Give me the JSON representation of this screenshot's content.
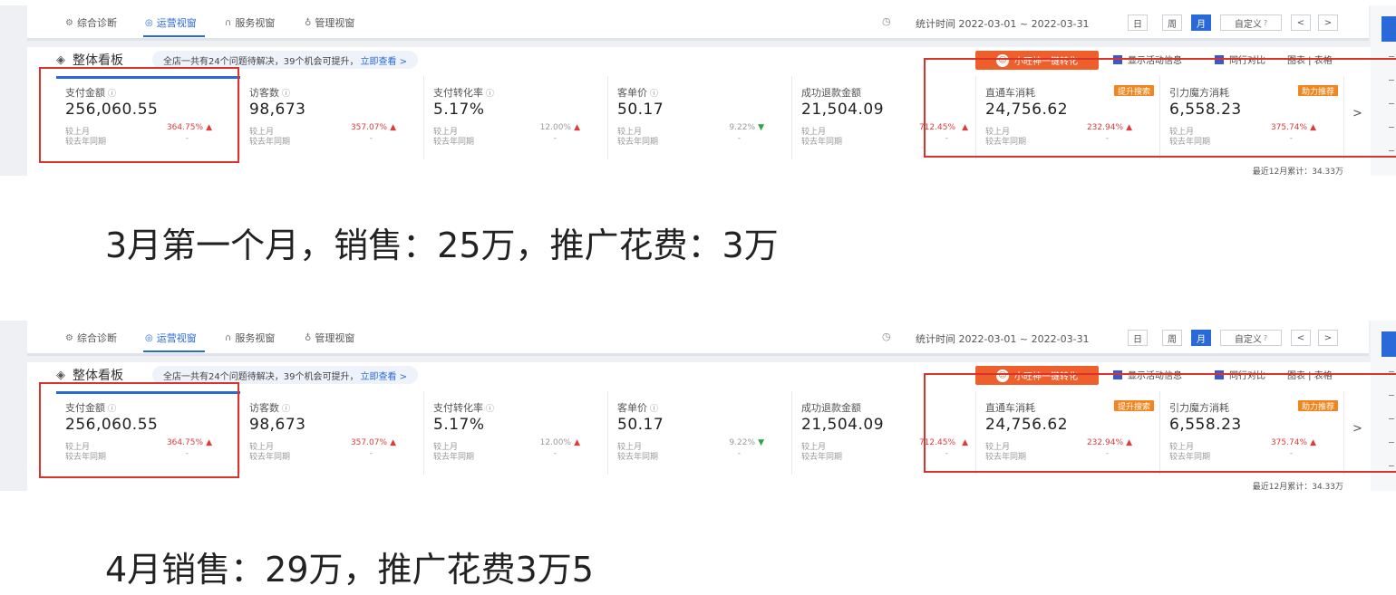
{
  "nav": {
    "tabs": [
      {
        "label": "综合诊断",
        "icon": "diagnosis-icon"
      },
      {
        "label": "运营视窗",
        "icon": "operation-icon",
        "active": true
      },
      {
        "label": "服务视窗",
        "icon": "headset-icon"
      },
      {
        "label": "管理视窗",
        "icon": "manage-icon"
      }
    ],
    "stat_time": "统计时间 2022-03-01 ~ 2022-03-31",
    "periods": [
      "日",
      "周",
      "月",
      "自定义"
    ],
    "active_period": "月",
    "prev": "<",
    "next": ">"
  },
  "board": {
    "title": "整体看板",
    "notice_text": "全店一共有24个问题待解决，39个机会可提升，",
    "notice_link": "立即查看 >",
    "banner": "小旺神一键转化",
    "option_activity": "显示活动信息",
    "option_peer": "同行对比",
    "option_view": "图表 | 表格",
    "footnote": "最近12月累计：34.33万",
    "compare_labels": [
      "较上月",
      "较去年同期"
    ],
    "metrics": [
      {
        "label": "支付金额",
        "value": "256,060.55",
        "mom": "364.75%",
        "trend": "up",
        "yoy": "-"
      },
      {
        "label": "访客数",
        "value": "98,673",
        "mom": "357.07%",
        "trend": "up",
        "yoy": "-"
      },
      {
        "label": "支付转化率",
        "value": "5.17%",
        "mom": "12.00%",
        "trend": "up",
        "yoy": "-"
      },
      {
        "label": "客单价",
        "value": "50.17",
        "mom": "9.22%",
        "trend": "down",
        "yoy": "-"
      },
      {
        "label": "成功退款金额",
        "value": "21,504.09",
        "mom": "712.45%",
        "trend": "up",
        "yoy": "-"
      },
      {
        "label": "直通车消耗",
        "value": "24,756.62",
        "mom": "232.94%",
        "trend": "up",
        "yoy": "-",
        "badge": "提升搜索"
      },
      {
        "label": "引力魔方消耗",
        "value": "6,558.23",
        "mom": "375.74%",
        "trend": "up",
        "yoy": "-",
        "badge": "助力推荐"
      }
    ]
  },
  "captions": {
    "first": "3月第一个月，销售：25万，推广花费：3万",
    "second": "4月销售：29万，推广花费3万5"
  },
  "colors": {
    "accent": "#2a6ad8",
    "highlight_box": "#d9342b",
    "banner": "#ef5f2b",
    "badge": "#f1861f"
  }
}
